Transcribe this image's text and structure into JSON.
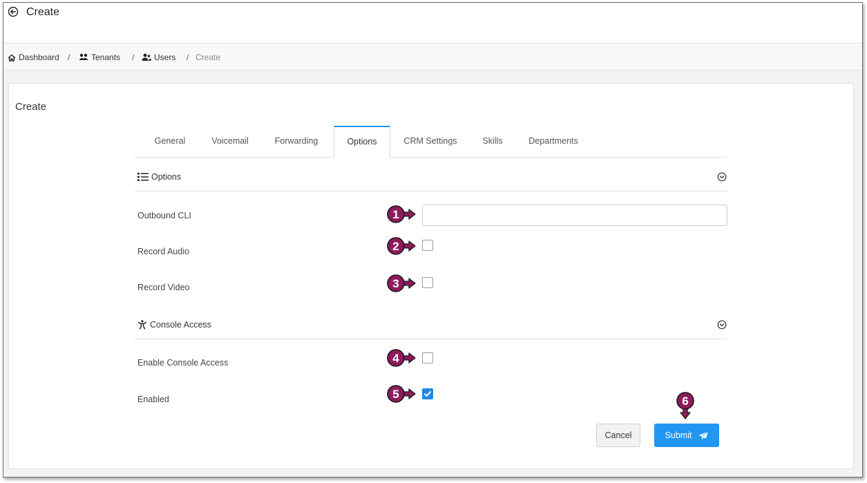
{
  "header": {
    "title": "Create"
  },
  "breadcrumb": {
    "dashboard": "Dashboard",
    "tenants": "Tenants",
    "users": "Users",
    "current": "Create",
    "separator": "/"
  },
  "card": {
    "title": "Create"
  },
  "tabs": [
    {
      "label": "General",
      "active": false
    },
    {
      "label": "Voicemail",
      "active": false
    },
    {
      "label": "Forwarding",
      "active": false
    },
    {
      "label": "Options",
      "active": true
    },
    {
      "label": "CRM Settings",
      "active": false
    },
    {
      "label": "Skills",
      "active": false
    },
    {
      "label": "Departments",
      "active": false
    }
  ],
  "options_section": {
    "title": "Options",
    "icon": "list-icon",
    "fields": {
      "outbound_cli": {
        "label": "Outbound CLI",
        "value": "",
        "placeholder": ""
      },
      "record_audio": {
        "label": "Record Audio",
        "checked": false
      },
      "record_video": {
        "label": "Record Video",
        "checked": false
      }
    }
  },
  "console_section": {
    "title": "Console Access",
    "icon": "person-icon",
    "fields": {
      "enable_console_access": {
        "label": "Enable Console Access",
        "checked": false
      },
      "enabled": {
        "label": "Enabled",
        "checked": true
      }
    }
  },
  "buttons": {
    "cancel": "Cancel",
    "submit": "Submit"
  },
  "markers": [
    "1",
    "2",
    "3",
    "4",
    "5",
    "6"
  ],
  "colors": {
    "accent": "#2196f3",
    "marker": "#8e1a5c",
    "checked": "#1e88e5"
  }
}
